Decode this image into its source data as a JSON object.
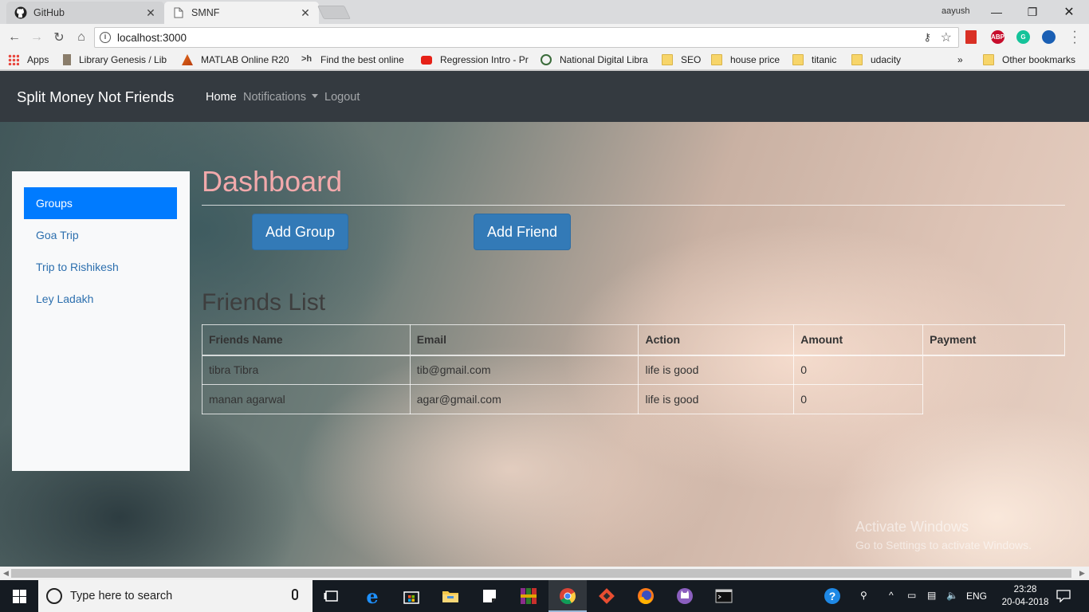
{
  "browser": {
    "tabs": [
      {
        "title": "GitHub",
        "icon": "github-icon",
        "active": false
      },
      {
        "title": "SMNF",
        "icon": "page-icon",
        "active": true
      }
    ],
    "profile_name": "aayush",
    "url": "localhost:3000",
    "bookmarks": [
      {
        "label": "Apps",
        "icon": "apps-grid-icon"
      },
      {
        "label": "Library Genesis / Lib",
        "icon": "book-icon"
      },
      {
        "label": "MATLAB Online R20",
        "icon": "matlab-icon"
      },
      {
        "label": "Find the best online",
        "icon": "hackerrank-icon"
      },
      {
        "label": "Regression Intro - Pr",
        "icon": "youtube-icon"
      },
      {
        "label": "National Digital Libra",
        "icon": "ndl-icon"
      },
      {
        "label": "SEO",
        "icon": "folder-icon"
      },
      {
        "label": "house price",
        "icon": "folder-icon"
      },
      {
        "label": "titanic",
        "icon": "folder-icon"
      },
      {
        "label": "udacity",
        "icon": "folder-icon"
      }
    ],
    "more_bookmarks": "»",
    "other_bookmarks": "Other bookmarks",
    "extensions": [
      {
        "name": "bookmark-ext-icon",
        "label": "",
        "color": "#d93025"
      },
      {
        "name": "adblock-plus-icon",
        "label": "ABP",
        "color": "#c70d2c"
      },
      {
        "name": "grammarly-icon",
        "label": "G",
        "color": "#15c39a"
      },
      {
        "name": "extension-icon",
        "label": "",
        "color": "#1a5fb4"
      }
    ]
  },
  "app": {
    "brand": "Split Money Not Friends",
    "nav": {
      "home": "Home",
      "notifications": "Notifications",
      "logout": "Logout"
    },
    "sidebar": {
      "items": [
        {
          "label": "Groups",
          "active": true
        },
        {
          "label": "Goa Trip",
          "active": false
        },
        {
          "label": "Trip to Rishikesh",
          "active": false
        },
        {
          "label": "Ley Ladakh",
          "active": false
        }
      ]
    },
    "dashboard_title": "Dashboard",
    "buttons": {
      "add_group": "Add Group",
      "add_friend": "Add Friend"
    },
    "friends_title": "Friends List",
    "table": {
      "headers": [
        "Friends Name",
        "Email",
        "Action",
        "Amount",
        "Payment"
      ],
      "rows": [
        [
          "tibra Tibra",
          "tib@gmail.com",
          "life is good",
          "0"
        ],
        [
          "manan agarwal",
          "agar@gmail.com",
          "life is good",
          "0"
        ]
      ]
    }
  },
  "watermark": {
    "line1": "Activate Windows",
    "line2": "Go to Settings to activate Windows."
  },
  "taskbar": {
    "search_placeholder": "Type here to search",
    "language": "ENG",
    "time": "23:28",
    "date": "20-04-2018",
    "pinned": [
      "task-view-icon",
      "edge-icon",
      "store-icon",
      "file-explorer-icon",
      "sticky-notes-icon",
      "winrar-icon",
      "chrome-icon",
      "git-icon",
      "firefox-icon",
      "cat-app-icon",
      "terminal-icon"
    ]
  },
  "colors": {
    "navbar_bg": "#343a40",
    "sidebar_active": "#007bff",
    "button_primary": "#337ab7",
    "dashboard_title": "#f2a9ab"
  }
}
